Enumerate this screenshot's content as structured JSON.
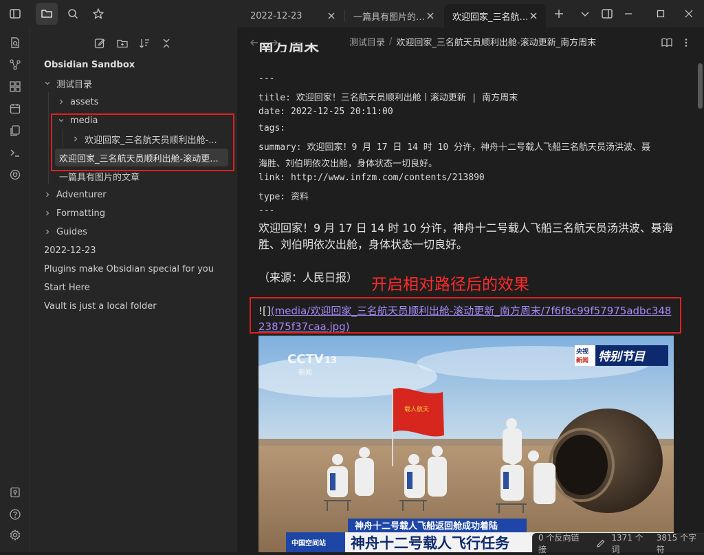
{
  "colors": {
    "accent": "#a88bfa",
    "annotation": "#ff2a2a",
    "highlight_box": "#e02020"
  },
  "titlebar": {
    "icons": [
      "sidebar-toggle-icon",
      "folder-icon",
      "search-icon",
      "star-icon"
    ],
    "tabs": [
      {
        "label": "2022-12-23",
        "active": false
      },
      {
        "label": "一篇具有图片的…",
        "active": false
      },
      {
        "label": "欢迎回家_三名航…",
        "active": true
      }
    ],
    "new_tab_icon": "plus-icon",
    "tab_list_icon": "chevron-down-icon",
    "right_sidebar_icon": "sidebar-right-icon",
    "window_buttons": [
      "minimize-icon",
      "maximize-icon",
      "close-icon"
    ]
  },
  "ribbon": {
    "top_icons": [
      "quick-switcher-icon",
      "graph-view-icon",
      "canvas-icon",
      "daily-note-icon",
      "templates-icon",
      "command-palette-icon",
      "plugin-icon"
    ],
    "bottom_icons": [
      "vault-switcher-icon",
      "help-icon",
      "settings-icon"
    ]
  },
  "sidebar": {
    "toolbar": [
      "new-note-icon",
      "new-folder-icon",
      "sort-icon",
      "collapse-all-icon"
    ],
    "vault_name": "Obsidian Sandbox",
    "tree": [
      {
        "label": "测试目录",
        "depth": 0,
        "chevron": "down"
      },
      {
        "label": "assets",
        "depth": 1,
        "chevron": "right"
      },
      {
        "label": "media",
        "depth": 1,
        "chevron": "down"
      },
      {
        "label": "欢迎回家_三名航天员顺利出舱-...",
        "depth": 2,
        "chevron": "right"
      },
      {
        "label": "欢迎回家_三名航天员顺利出舱-滚动更...",
        "depth": 1,
        "chevron": "none",
        "selected": true
      },
      {
        "label": "一篇具有图片的文章",
        "depth": 1,
        "chevron": "none"
      },
      {
        "label": "Adventurer",
        "depth": 0,
        "chevron": "right"
      },
      {
        "label": "Formatting",
        "depth": 0,
        "chevron": "right"
      },
      {
        "label": "Guides",
        "depth": 0,
        "chevron": "right"
      },
      {
        "label": "2022-12-23",
        "depth": 0,
        "chevron": "none"
      },
      {
        "label": "Plugins make Obsidian special for you",
        "depth": 0,
        "chevron": "none"
      },
      {
        "label": "Start Here",
        "depth": 0,
        "chevron": "none"
      },
      {
        "label": "Vault is just a local folder",
        "depth": 0,
        "chevron": "none"
      }
    ]
  },
  "main": {
    "breadcrumb": {
      "folder": "测试目录",
      "separator": "/",
      "note": "欢迎回家_三名航天员顺利出舱-滚动更新_南方周末"
    },
    "header_icons": [
      "back-arrow-icon",
      "forward-arrow-icon",
      "reading-mode-icon",
      "more-options-icon"
    ],
    "cut_heading": "南方周末",
    "frontmatter": [
      "---",
      "title: 欢迎回家！三名航天员顺利出舱丨滚动更新 | 南方周末",
      "date: 2022-12-25 20:11:00",
      "tags:",
      "summary: 欢迎回家！9 月 17 日 14 时 10 分许，神舟十二号载人飞船三名航天员汤洪波、聂",
      "海胜、刘伯明依次出舱，身体状态一切良好。",
      "link: http://www.infzm.com/contents/213890",
      "type: 资料",
      "---"
    ],
    "paragraph_lines": [
      "欢迎回家！9 月 17 日 14 时 10 分许，神舟十二号载人飞船三名航天员汤洪波、聂海",
      "胜、刘伯明依次出舱，身体状态一切良好。"
    ],
    "source": "（来源：人民日报）",
    "annotation": "开启相对路径后的效果",
    "image_link": {
      "prefix": "![]",
      "line1": "(media/欢迎回家_三名航天员顺利出舱-滚动更新_南方周末/7f6f8c99f57975adbc348",
      "line2": "23875f37caa.jpg)"
    },
    "photo": {
      "channel_logo": "CCTV",
      "channel_number": "13",
      "channel_sub": "新闻",
      "badge_small_top": "央视",
      "badge_small_bottom": "新闻",
      "badge_text": "特别节目",
      "flag_text": "载人航天",
      "caption_top": "神舟十二号载人飞船返回舱成功着陆",
      "caption_bottom": "神舟十二号载人飞行任务",
      "station_logo": "中国空间站"
    }
  },
  "statusbar": {
    "backlinks": "0 个反向链接",
    "edit_icon": "pencil-icon",
    "words": "1371 个词",
    "chars": "3815 个字符"
  }
}
